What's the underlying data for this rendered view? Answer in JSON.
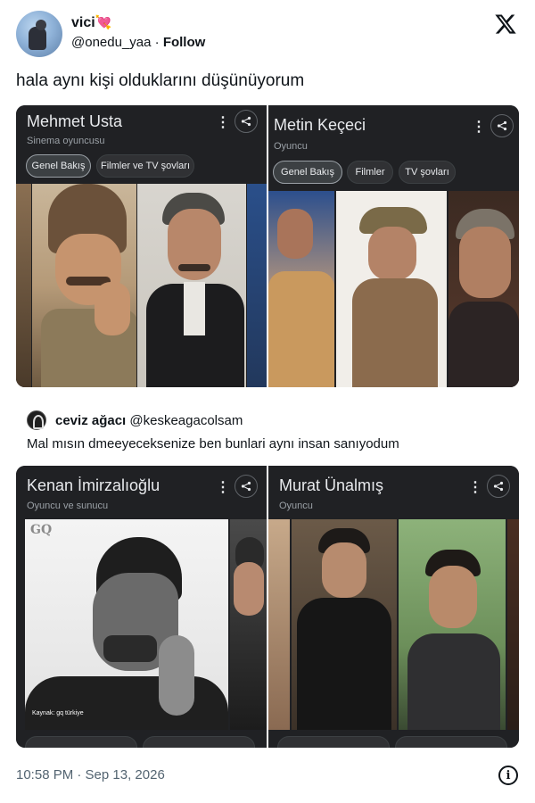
{
  "author": {
    "name": "vici",
    "emoji": "💘",
    "handle": "@onedu_yaa",
    "separator": "·",
    "follow_label": "Follow"
  },
  "tweet_text": "hala aynı kişi olduklarını düşünüyorum",
  "top_cards": [
    {
      "title": "Mehmet Usta",
      "subtitle": "Sinema oyuncusu",
      "chips": [
        "Genel Bakış",
        "Filmler ve TV şovları"
      ]
    },
    {
      "title": "Metin Keçeci",
      "subtitle": "Oyuncu",
      "chips": [
        "Genel Bakış",
        "Filmler",
        "TV şovları"
      ]
    }
  ],
  "quote": {
    "name": "ceviz ağacı",
    "handle": "@keskeagacolsam",
    "text": "Mal mısın dmeeyeceksenize ben bunlari aynı insan sanıyodum"
  },
  "bottom_cards": [
    {
      "title": "Kenan İmirzalıoğlu",
      "subtitle": "Oyuncu ve sunucu",
      "photo_source": "Kaynak: gq türkiye",
      "watermark": "GQ"
    },
    {
      "title": "Murat Ünalmış",
      "subtitle": "Oyuncu"
    }
  ],
  "menu_glyph": "⋮",
  "timestamp": "10:58 PM · Sep 13, 2026",
  "info_glyph": "i"
}
